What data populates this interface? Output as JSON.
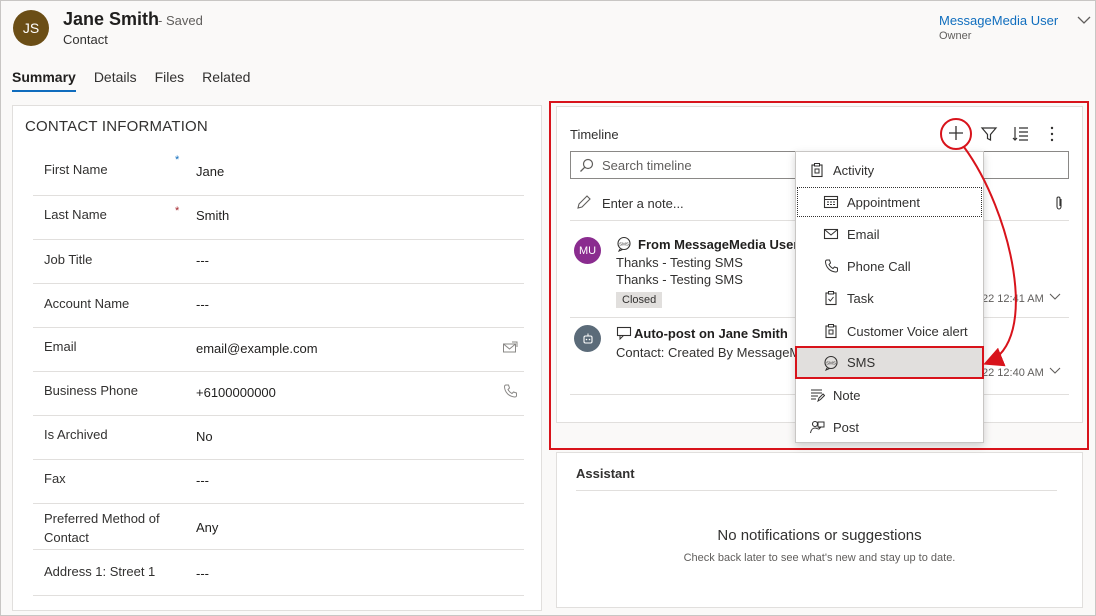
{
  "header": {
    "initials": "JS",
    "name": "Jane Smith",
    "saved": "- Saved",
    "entity": "Contact",
    "owner_name": "MessageMedia User",
    "owner_label": "Owner"
  },
  "tabs": [
    {
      "label": "Summary",
      "active": true
    },
    {
      "label": "Details",
      "active": false
    },
    {
      "label": "Files",
      "active": false
    },
    {
      "label": "Related",
      "active": false
    }
  ],
  "contact": {
    "section_title": "CONTACT INFORMATION",
    "fields": [
      {
        "label": "First Name",
        "value": "Jane",
        "required_mark": "*"
      },
      {
        "label": "Last Name",
        "value": "Smith",
        "required_mark": "*"
      },
      {
        "label": "Job Title",
        "value": "---"
      },
      {
        "label": "Account Name",
        "value": "---"
      },
      {
        "label": "Email",
        "value": "email@example.com",
        "action_icon": "email-compose-icon"
      },
      {
        "label": "Business Phone",
        "value": "+6100000000",
        "action_icon": "phone-icon"
      },
      {
        "label": "Is Archived",
        "value": "No"
      },
      {
        "label": "Fax",
        "value": "---"
      },
      {
        "label": "Preferred Method of Contact",
        "value": "Any"
      },
      {
        "label": "Address 1: Street 1",
        "value": "---"
      }
    ]
  },
  "timeline": {
    "title": "Timeline",
    "search_placeholder": "Search timeline",
    "note_placeholder": "Enter a note...",
    "entries": [
      {
        "avatar": "MU",
        "avatar_color": "#8a2c8f",
        "title": "From MessageMedia User",
        "lines": [
          "Thanks - Testing SMS",
          "Thanks - Testing SMS"
        ],
        "badge": "Closed",
        "time": "22 12:41 AM"
      },
      {
        "avatar_icon": "bot-icon",
        "title": "Auto-post on Jane Smith",
        "lines": [
          "Contact: Created By MessageMed"
        ],
        "time": "22 12:40 AM"
      }
    ]
  },
  "menu": {
    "items": [
      {
        "label": "Activity",
        "icon": "clipboard-icon"
      },
      {
        "label": "Appointment",
        "icon": "calendar-icon"
      },
      {
        "label": "Email",
        "icon": "mail-icon"
      },
      {
        "label": "Phone Call",
        "icon": "phone-icon"
      },
      {
        "label": "Task",
        "icon": "task-icon"
      },
      {
        "label": "Customer Voice alert",
        "icon": "clipboard-icon"
      },
      {
        "label": "SMS",
        "icon": "sms-icon",
        "highlighted": true
      },
      {
        "label": "Note",
        "icon": "note-icon"
      },
      {
        "label": "Post",
        "icon": "post-icon"
      }
    ]
  },
  "assistant": {
    "title": "Assistant",
    "empty_title": "No notifications or suggestions",
    "empty_subtitle": "Check back later to see what's new and stay up to date."
  },
  "colors": {
    "annotation_red": "#d8131b",
    "link_blue": "#106ebe",
    "avatar_brown": "#6b4e16"
  }
}
